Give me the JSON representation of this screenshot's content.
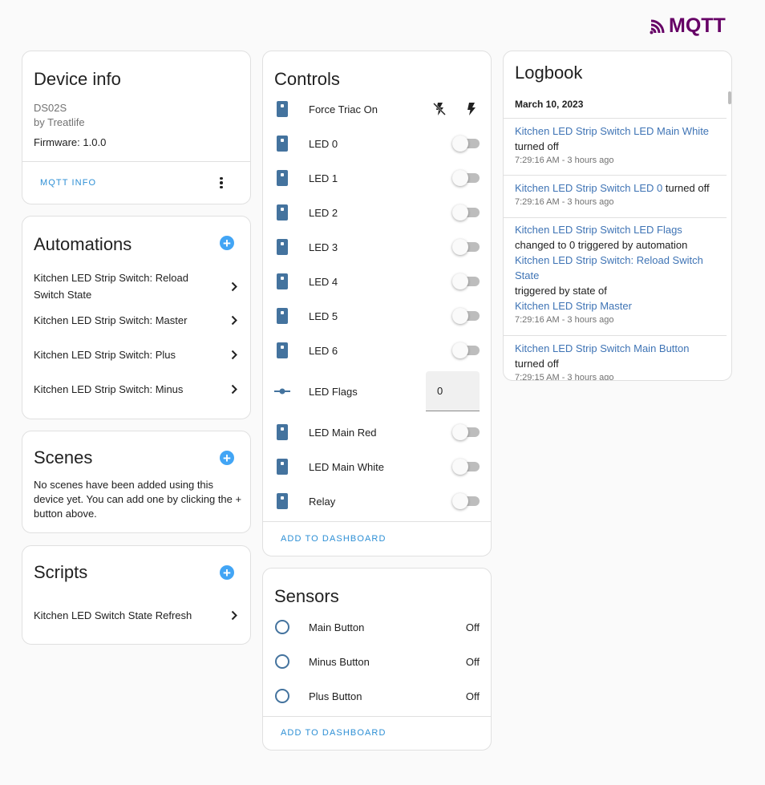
{
  "logo": {
    "text": "MQTT"
  },
  "device_info": {
    "title": "Device info",
    "model": "DS02S",
    "manufacturer": "by Treatlife",
    "firmware": "Firmware: 1.0.0",
    "mqtt_info_label": "MQTT INFO"
  },
  "automations": {
    "title": "Automations",
    "items": [
      "Kitchen LED Strip Switch: Reload Switch State",
      "Kitchen LED Strip Switch: Master",
      "Kitchen LED Strip Switch: Plus",
      "Kitchen LED Strip Switch: Minus"
    ]
  },
  "scenes": {
    "title": "Scenes",
    "empty_text": "No scenes have been added using this device yet. You can add one by clicking the + button above."
  },
  "scripts": {
    "title": "Scripts",
    "items": [
      "Kitchen LED Switch State Refresh"
    ]
  },
  "controls": {
    "title": "Controls",
    "force_triac": "Force Triac On",
    "items": [
      "LED 0",
      "LED 1",
      "LED 2",
      "LED 3",
      "LED 4",
      "LED 5",
      "LED 6"
    ],
    "led_flags": {
      "label": "LED Flags",
      "value": "0"
    },
    "items2": [
      "LED Main Red",
      "LED Main White",
      "Relay"
    ],
    "add_to_dashboard": "ADD TO DASHBOARD"
  },
  "sensors": {
    "title": "Sensors",
    "items": [
      {
        "name": "Main Button",
        "state": "Off"
      },
      {
        "name": "Minus Button",
        "state": "Off"
      },
      {
        "name": "Plus Button",
        "state": "Off"
      }
    ],
    "add_to_dashboard": "ADD TO DASHBOARD"
  },
  "logbook": {
    "title": "Logbook",
    "date": "March 10, 2023",
    "entries": [
      {
        "link": "Kitchen LED Strip Switch LED Main White",
        "text": "turned off",
        "time": "7:29:16 AM - 3 hours ago"
      },
      {
        "link": "Kitchen LED Strip Switch LED 0",
        "text": "turned off",
        "time": "7:29:16 AM - 3 hours ago"
      },
      {
        "link": "Kitchen LED Strip Switch LED Flags",
        "text": "changed to 0 triggered by automation",
        "link2": "Kitchen LED Strip Switch: Reload Switch State",
        "text2": "triggered by state of",
        "link3": "Kitchen LED Strip Master",
        "time": "7:29:16 AM - 3 hours ago"
      },
      {
        "link": "Kitchen LED Strip Switch Main Button",
        "text": "turned off",
        "time": "7:29:15 AM - 3 hours ago"
      }
    ]
  },
  "colors": {
    "accent": "#42a5f5",
    "link": "#3f74b5",
    "icon": "#44739e",
    "brand": "#660066"
  }
}
